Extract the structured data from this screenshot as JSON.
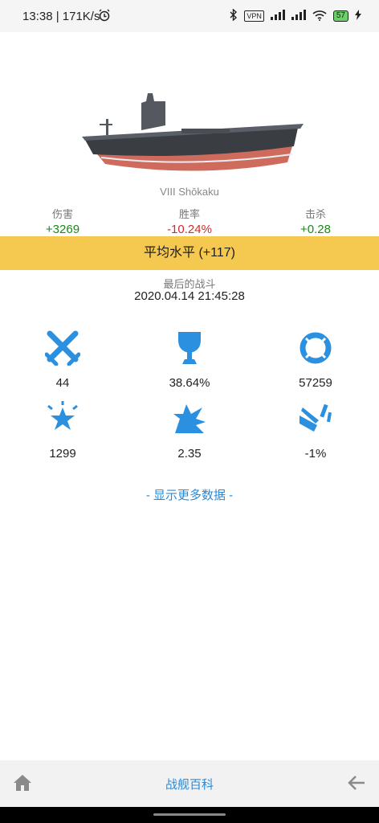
{
  "status": {
    "time_speed": "13:38 | 171K/s",
    "vpn": "VPN",
    "battery": "57"
  },
  "ship": {
    "name": "VIII Shōkaku"
  },
  "deltas": [
    {
      "label": "伤害",
      "value": "+3269",
      "tone": "pos"
    },
    {
      "label": "胜率",
      "value": "-10.24%",
      "tone": "neg"
    },
    {
      "label": "击杀",
      "value": "+0.28",
      "tone": "pos"
    }
  ],
  "banner": "平均水平 (+117)",
  "last_battle": {
    "label": "最后的战斗",
    "value": "2020.04.14 21:45:28"
  },
  "stats": [
    {
      "icon": "crossed-swords-icon",
      "value": "44"
    },
    {
      "icon": "trophy-icon",
      "value": "38.64%"
    },
    {
      "icon": "lifebuoy-icon",
      "value": "57259"
    },
    {
      "icon": "star-burst-icon",
      "value": "1299"
    },
    {
      "icon": "explosion-icon",
      "value": "2.35"
    },
    {
      "icon": "shrapnel-icon",
      "value": "-1%"
    }
  ],
  "more_link": "- 显示更多数据 -",
  "nav": {
    "title": "战舰百科"
  },
  "colors": {
    "accent": "#2a8ad8",
    "banner": "#f5c84f",
    "positive": "#188a18",
    "negative": "#d12b2b"
  }
}
